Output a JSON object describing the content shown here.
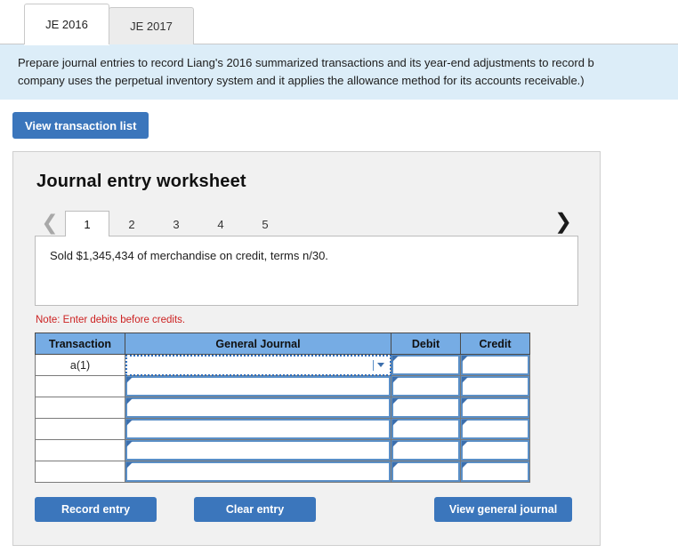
{
  "tabs": [
    {
      "label": "JE 2016",
      "active": true
    },
    {
      "label": "JE 2017",
      "active": false
    }
  ],
  "banner": {
    "line1": "Prepare journal entries to record Liang's 2016 summarized transactions and its year-end adjustments to record b",
    "line2": "company uses the perpetual inventory system and it applies the allowance method for its accounts receivable.)"
  },
  "toolbar": {
    "view_transaction_list_label": "View transaction list"
  },
  "worksheet": {
    "title": "Journal entry worksheet",
    "prev_icon": "chevron-left-icon",
    "next_icon": "chevron-right-icon",
    "pages": [
      {
        "label": "1",
        "active": true
      },
      {
        "label": "2",
        "active": false
      },
      {
        "label": "3",
        "active": false
      },
      {
        "label": "4",
        "active": false
      },
      {
        "label": "5",
        "active": false
      }
    ],
    "description": "Sold $1,345,434 of merchandise on credit, terms n/30.",
    "note": "Note: Enter debits before credits.",
    "table": {
      "headers": [
        "Transaction",
        "General Journal",
        "Debit",
        "Credit"
      ],
      "rows": [
        {
          "transaction": "a(1)",
          "general_journal": "",
          "debit": "",
          "credit": "",
          "focused": true
        },
        {
          "transaction": "",
          "general_journal": "",
          "debit": "",
          "credit": "",
          "focused": false
        },
        {
          "transaction": "",
          "general_journal": "",
          "debit": "",
          "credit": "",
          "focused": false
        },
        {
          "transaction": "",
          "general_journal": "",
          "debit": "",
          "credit": "",
          "focused": false
        },
        {
          "transaction": "",
          "general_journal": "",
          "debit": "",
          "credit": "",
          "focused": false
        },
        {
          "transaction": "",
          "general_journal": "",
          "debit": "",
          "credit": "",
          "focused": false
        }
      ]
    },
    "actions": {
      "record_label": "Record entry",
      "clear_label": "Clear entry",
      "view_journal_label": "View general journal"
    }
  },
  "colors": {
    "button_blue": "#3b76bc",
    "table_header_blue": "#76ace4",
    "banner_blue": "#dcedf8",
    "panel_gray": "#f1f1f1",
    "note_red": "#cc2222",
    "cell_marker_blue": "#3c6fad"
  }
}
